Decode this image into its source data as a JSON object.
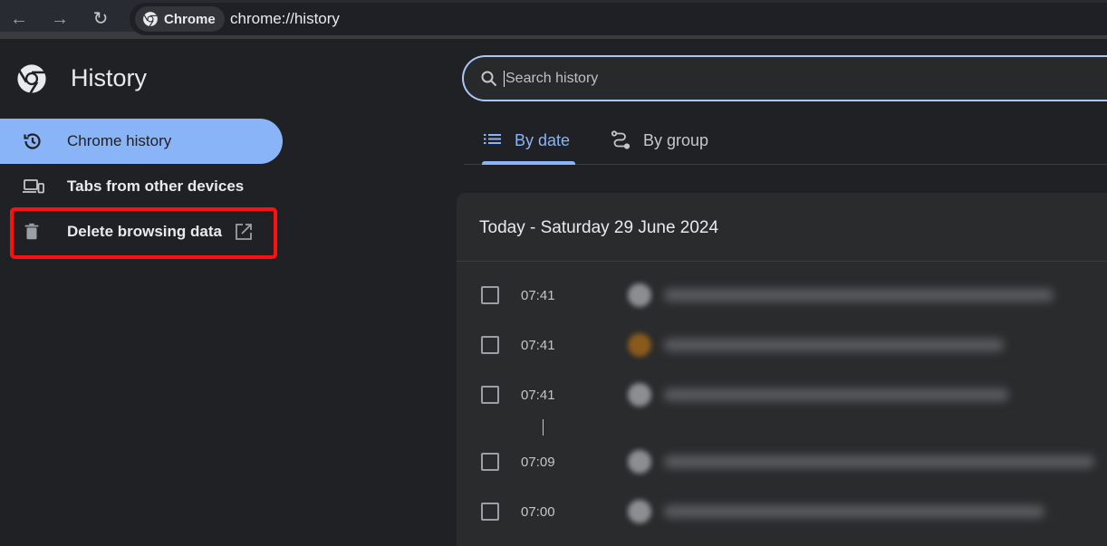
{
  "browser": {
    "back_icon": "arrow-left-icon",
    "forward_icon": "arrow-right-icon",
    "reload_icon": "reload-icon",
    "chip_label": "Chrome",
    "url": "chrome://history"
  },
  "sidebar": {
    "title": "History",
    "items": [
      {
        "label": "Chrome history",
        "icon": "history-icon",
        "active": true
      },
      {
        "label": "Tabs from other devices",
        "icon": "devices-icon",
        "active": false
      },
      {
        "label": "Delete browsing data",
        "icon": "trash-icon",
        "trailing_icon": "open-in-new-icon",
        "active": false,
        "highlighted": true
      }
    ]
  },
  "search": {
    "placeholder": "Search history",
    "value": ""
  },
  "tabs": [
    {
      "label": "By date",
      "icon": "list-icon",
      "active": true
    },
    {
      "label": "By group",
      "icon": "route-icon",
      "active": false
    }
  ],
  "history": {
    "date_heading": "Today - Saturday 29 June 2024",
    "entries": [
      {
        "time": "07:41",
        "favicon_color": "#8d8e91",
        "title": "(blurred)"
      },
      {
        "time": "07:41",
        "favicon_color": "#8a5a1c",
        "title": "(blurred)"
      },
      {
        "time": "07:41",
        "favicon_color": "#8d8e91",
        "title": "(blurred)"
      },
      {
        "time": "07:09",
        "favicon_color": "#8d8e91",
        "title": "(blurred)"
      },
      {
        "time": "07:00",
        "favicon_color": "#8d8e91",
        "title": "(blurred)"
      }
    ]
  },
  "colors": {
    "accent": "#8ab4f8",
    "highlight_box": "#ff1010",
    "background": "#202124"
  }
}
